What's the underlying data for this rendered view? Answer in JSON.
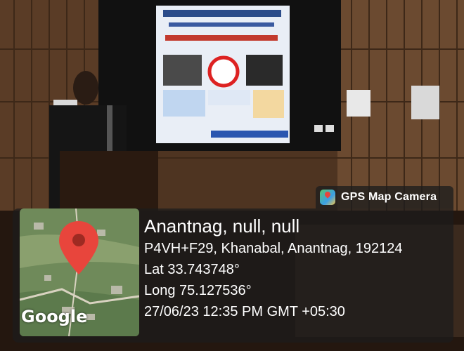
{
  "badge": {
    "label": "GPS Map Camera",
    "icon": "gps-map-camera-icon"
  },
  "location": {
    "place": "Anantnag, null, null",
    "address": "P4VH+F29, Khanabal, Anantnag, 192124",
    "latitude": "Lat 33.743748°",
    "longitude": "Long 75.127536°",
    "datetime": "27/06/23 12:35 PM GMT +05:30"
  },
  "map": {
    "attribution": "Google",
    "pin_color": "#e8453c",
    "icon": "map-pin-icon"
  }
}
